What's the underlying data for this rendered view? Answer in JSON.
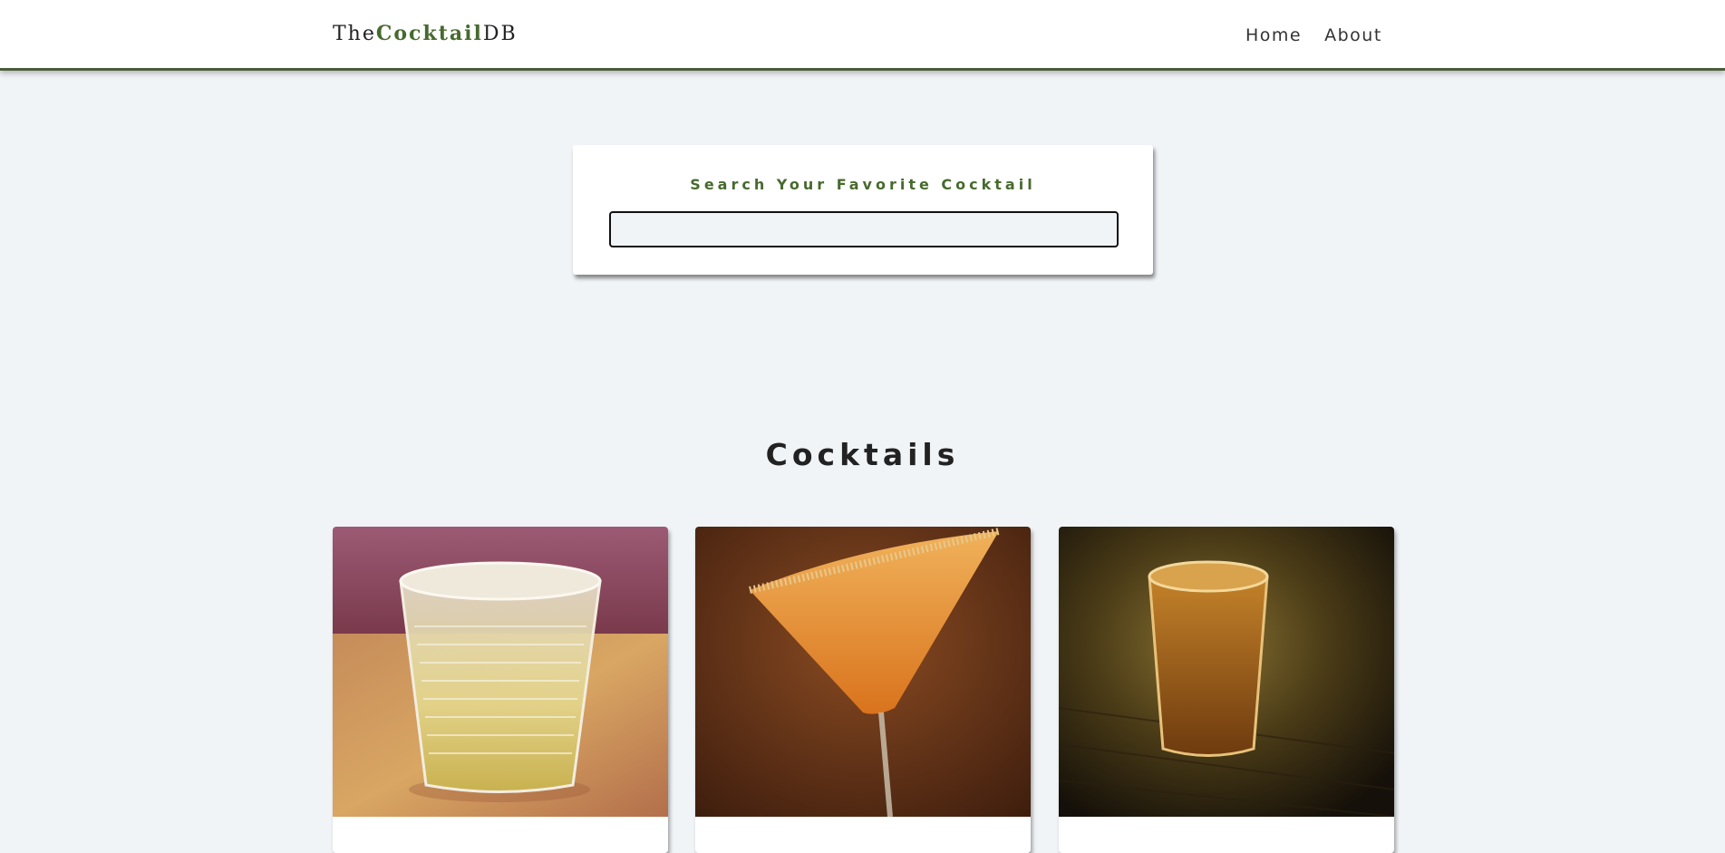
{
  "navbar": {
    "logo_prefix": "The",
    "logo_brand": "Cocktail",
    "logo_suffix": "DB",
    "links": [
      "Home",
      "About"
    ]
  },
  "search": {
    "label": "Search Your Favorite Cocktail",
    "value": ""
  },
  "section": {
    "title": "Cocktails"
  },
  "cards": [
    {
      "image": "drink-image-glass-on-ice"
    },
    {
      "image": "drink-image-martini-orange"
    },
    {
      "image": "drink-image-shot-glass-whiskey"
    }
  ],
  "colors": {
    "accent": "#476a2e",
    "background": "#f0f4f7",
    "navbar_border": "#4b5d3a"
  }
}
